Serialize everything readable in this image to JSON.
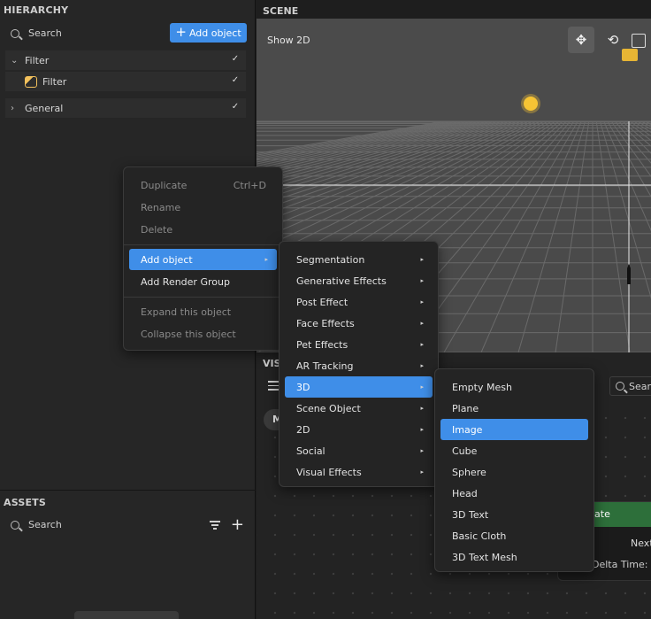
{
  "hierarchy": {
    "title": "HIERARCHY",
    "search_placeholder": "Search",
    "add_button": "Add object",
    "tree": [
      {
        "label": "Filter",
        "expanded": true
      },
      {
        "label": "Filter",
        "icon": "filter-icon"
      },
      {
        "label": "General",
        "expanded": false
      }
    ]
  },
  "assets": {
    "title": "ASSETS",
    "search_placeholder": "Search"
  },
  "scene": {
    "title": "SCENE",
    "show2d": "Show 2D"
  },
  "visual": {
    "label": "VIS",
    "search": "Searc",
    "node_title": "late",
    "node_next": "Next",
    "node_delta": "Delta Time: N",
    "tab_initial": "M"
  },
  "context_menu": {
    "items": [
      {
        "label": "Duplicate",
        "shortcut": "Ctrl+D",
        "disabled": true
      },
      {
        "label": "Rename",
        "disabled": true
      },
      {
        "label": "Delete",
        "disabled": true
      },
      {
        "label": "Add object",
        "submenu": true,
        "active": true
      },
      {
        "label": "Add Render Group"
      },
      {
        "label": "Expand this object",
        "disabled": true
      },
      {
        "label": "Collapse this object",
        "disabled": true
      }
    ]
  },
  "add_object_menu": {
    "items": [
      "Segmentation",
      "Generative Effects",
      "Post Effect",
      "Face Effects",
      "Pet Effects",
      "AR Tracking",
      "3D",
      "Scene Object",
      "2D",
      "Social",
      "Visual Effects"
    ],
    "active": "3D"
  },
  "menu_3d": {
    "items": [
      "Empty Mesh",
      "Plane",
      "Image",
      "Cube",
      "Sphere",
      "Head",
      "3D Text",
      "Basic Cloth",
      "3D Text Mesh"
    ],
    "active": "Image"
  },
  "colors": {
    "accent": "#3f8ee8",
    "panel": "#262626",
    "viewport": "#4a4a4a"
  }
}
